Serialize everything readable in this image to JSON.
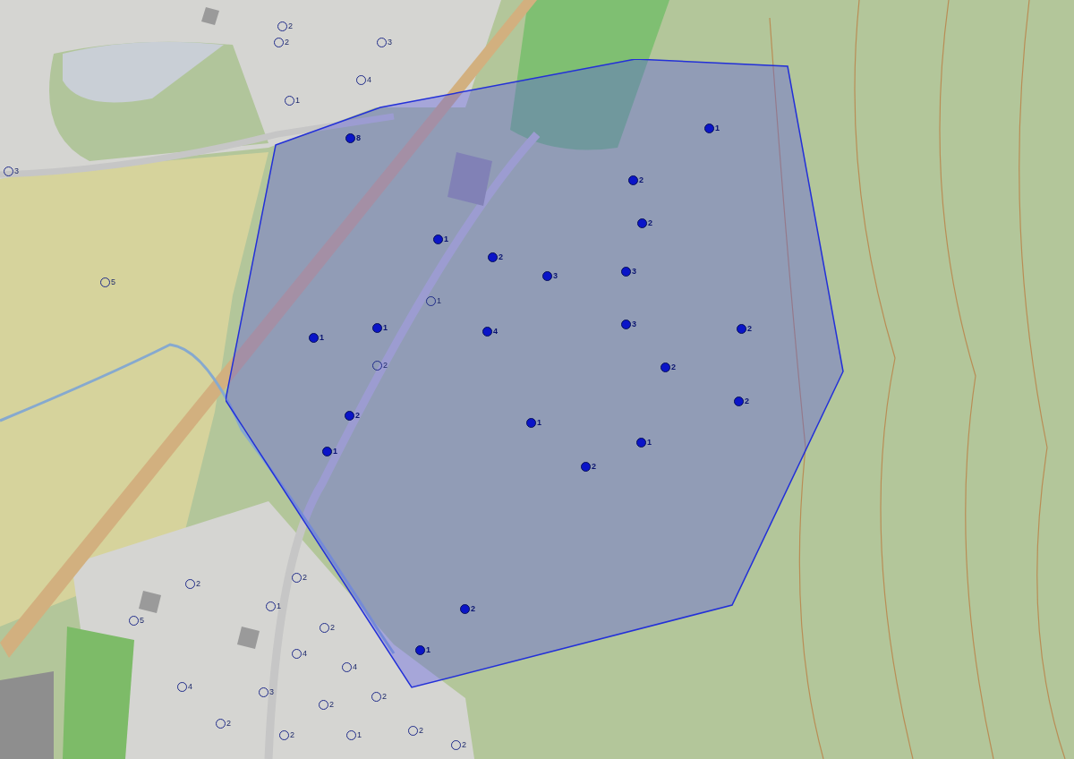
{
  "markers": [
    {
      "label": "8",
      "selected": true
    },
    {
      "label": "1",
      "selected": true
    },
    {
      "label": "2",
      "selected": true
    },
    {
      "label": "3",
      "selected": true
    },
    {
      "label": "1",
      "selected": true
    },
    {
      "label": "1",
      "selected": true
    },
    {
      "label": "4",
      "selected": true
    },
    {
      "label": "2",
      "selected": true
    },
    {
      "label": "1",
      "selected": true
    },
    {
      "label": "1",
      "selected": true
    },
    {
      "label": "1",
      "selected": true
    },
    {
      "label": "2",
      "selected": true
    },
    {
      "label": "2",
      "selected": true
    },
    {
      "label": "3",
      "selected": true
    },
    {
      "label": "3",
      "selected": true
    },
    {
      "label": "2",
      "selected": true
    },
    {
      "label": "2",
      "selected": true
    },
    {
      "label": "2",
      "selected": true
    },
    {
      "label": "1",
      "selected": true
    },
    {
      "label": "2",
      "selected": true
    },
    {
      "label": "2",
      "selected": true
    },
    {
      "label": "1",
      "selected": true
    },
    {
      "label": "2",
      "selected": false
    },
    {
      "label": "2",
      "selected": false
    },
    {
      "label": "3",
      "selected": false
    },
    {
      "label": "4",
      "selected": false
    },
    {
      "label": "1",
      "selected": false
    },
    {
      "label": "3",
      "selected": false
    },
    {
      "label": "5",
      "selected": false
    },
    {
      "label": "1",
      "selected": false
    },
    {
      "label": "2",
      "selected": false
    },
    {
      "label": "2",
      "selected": false
    },
    {
      "label": "5",
      "selected": false
    },
    {
      "label": "1",
      "selected": false
    },
    {
      "label": "2",
      "selected": false
    },
    {
      "label": "2",
      "selected": false
    },
    {
      "label": "4",
      "selected": false
    },
    {
      "label": "4",
      "selected": false
    },
    {
      "label": "4",
      "selected": false
    },
    {
      "label": "3",
      "selected": false
    },
    {
      "label": "2",
      "selected": false
    },
    {
      "label": "2",
      "selected": false
    },
    {
      "label": "2",
      "selected": false
    },
    {
      "label": "2",
      "selected": false
    },
    {
      "label": "1",
      "selected": false
    },
    {
      "label": "2",
      "selected": false
    },
    {
      "label": "2",
      "selected": false
    }
  ]
}
